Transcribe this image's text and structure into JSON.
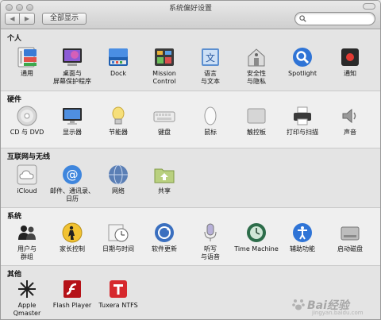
{
  "window": {
    "title": "系统偏好设置"
  },
  "toolbar": {
    "back_glyph": "◀",
    "forward_glyph": "▶",
    "show_all_label": "全部显示",
    "search_placeholder": "Spotlight search",
    "search_value": ""
  },
  "sections": [
    {
      "title": "个人",
      "items": [
        {
          "label": "通用",
          "icon": "general-icon"
        },
        {
          "label": "桌面与\n屏幕保护程序",
          "icon": "desktop-icon"
        },
        {
          "label": "Dock",
          "icon": "dock-icon"
        },
        {
          "label": "Mission\nControl",
          "icon": "mission-control-icon"
        },
        {
          "label": "语言\n与文本",
          "icon": "language-icon"
        },
        {
          "label": "安全性\n与隐私",
          "icon": "security-icon"
        },
        {
          "label": "Spotlight",
          "icon": "spotlight-icon"
        },
        {
          "label": "通知",
          "icon": "notifications-icon"
        }
      ]
    },
    {
      "title": "硬件",
      "items": [
        {
          "label": "CD 与 DVD",
          "icon": "cd-dvd-icon"
        },
        {
          "label": "显示器",
          "icon": "display-icon"
        },
        {
          "label": "节能器",
          "icon": "energy-saver-icon"
        },
        {
          "label": "键盘",
          "icon": "keyboard-icon"
        },
        {
          "label": "鼠标",
          "icon": "mouse-icon"
        },
        {
          "label": "触控板",
          "icon": "trackpad-icon"
        },
        {
          "label": "打印与扫描",
          "icon": "printer-icon"
        },
        {
          "label": "声音",
          "icon": "sound-icon"
        }
      ]
    },
    {
      "title": "互联网与无线",
      "items": [
        {
          "label": "iCloud",
          "icon": "icloud-icon"
        },
        {
          "label": "邮件、通讯录、\n日历",
          "icon": "mail-icon"
        },
        {
          "label": "网络",
          "icon": "network-icon"
        },
        {
          "label": "共享",
          "icon": "sharing-icon"
        }
      ]
    },
    {
      "title": "系统",
      "items": [
        {
          "label": "用户与\n群组",
          "icon": "users-icon"
        },
        {
          "label": "家长控制",
          "icon": "parental-controls-icon"
        },
        {
          "label": "日期与时间",
          "icon": "date-time-icon"
        },
        {
          "label": "软件更新",
          "icon": "software-update-icon"
        },
        {
          "label": "听写\n与语音",
          "icon": "dictation-icon"
        },
        {
          "label": "Time Machine",
          "icon": "time-machine-icon"
        },
        {
          "label": "辅助功能",
          "icon": "accessibility-icon"
        },
        {
          "label": "启动磁盘",
          "icon": "startup-disk-icon"
        }
      ]
    },
    {
      "title": "其他",
      "items": [
        {
          "label": "Apple\nQmaster",
          "icon": "qmaster-icon"
        },
        {
          "label": "Flash Player",
          "icon": "flash-player-icon"
        },
        {
          "label": "Tuxera NTFS",
          "icon": "tuxera-ntfs-icon"
        }
      ]
    }
  ],
  "watermark": {
    "text": "Bai经验",
    "sub": "jingyan.baidu.com"
  }
}
